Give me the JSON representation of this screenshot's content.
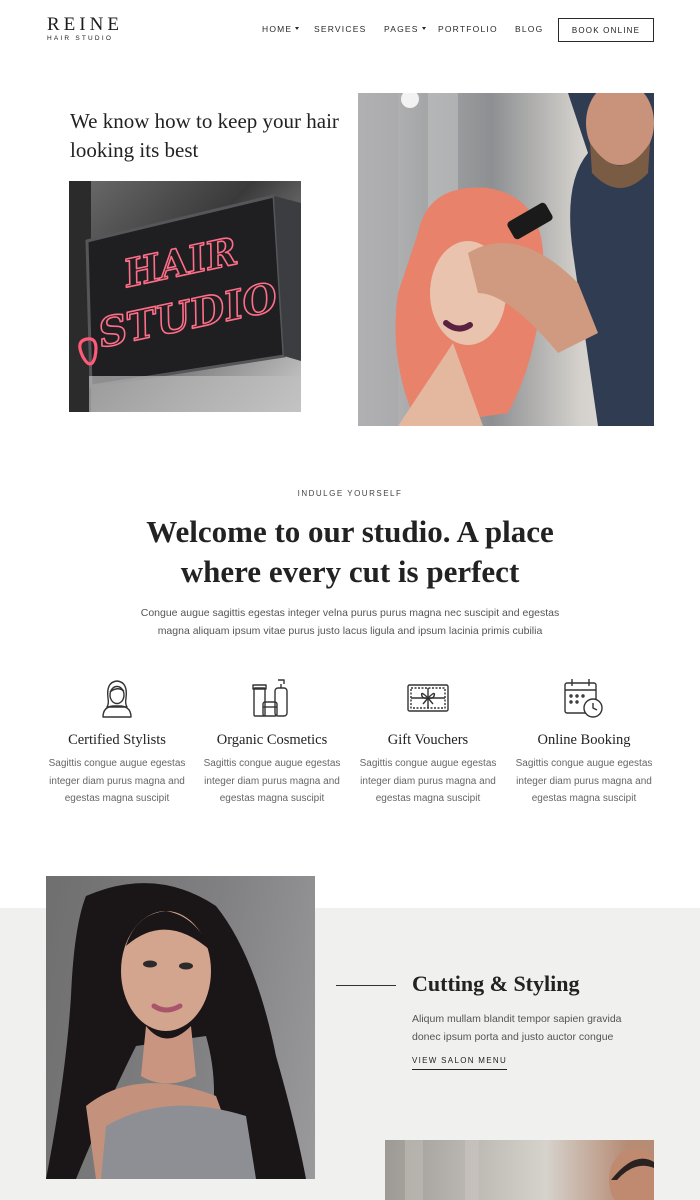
{
  "header": {
    "logo_main": "REINE",
    "logo_sub": "HAIR STUDIO",
    "nav": [
      {
        "label": "HOME",
        "has_dropdown": true
      },
      {
        "label": "SERVICES",
        "has_dropdown": false
      },
      {
        "label": "PAGES",
        "has_dropdown": true
      },
      {
        "label": "PORTFOLIO",
        "has_dropdown": false
      },
      {
        "label": "BLOG",
        "has_dropdown": false
      }
    ],
    "book_button": "BOOK ONLINE"
  },
  "hero": {
    "tagline": "We know how to keep your hair looking its best",
    "sign_text": "HAIR STUDIO"
  },
  "welcome": {
    "eyebrow": "INDULGE YOURSELF",
    "title": "Welcome to our studio. A place where every cut is perfect",
    "body": "Congue augue sagittis egestas integer velna purus purus magna nec suscipit and egestas magna aliquam ipsum vitae purus justo lacus ligula and ipsum lacinia primis cubilia"
  },
  "features": [
    {
      "icon": "stylist-icon",
      "title": "Certified Stylists",
      "text": "Sagittis congue augue egestas integer diam purus magna and egestas magna suscipit"
    },
    {
      "icon": "cosmetics-icon",
      "title": "Organic Cosmetics",
      "text": "Sagittis congue augue egestas integer diam purus magna and egestas magna suscipit"
    },
    {
      "icon": "gift-voucher-icon",
      "title": "Gift Vouchers",
      "text": "Sagittis congue augue egestas integer diam purus magna and egestas magna suscipit"
    },
    {
      "icon": "calendar-clock-icon",
      "title": "Online Booking",
      "text": "Sagittis congue augue egestas integer diam purus magna and egestas magna suscipit"
    }
  ],
  "cutting": {
    "title": "Cutting & Styling",
    "body": "Aliqum mullam blandit tempor sapien gravida donec ipsum porta and justo auctor congue",
    "link": "VIEW SALON MENU"
  },
  "colors": {
    "text": "#222222",
    "band": "#f0f0ee",
    "neon": "#ff5a78",
    "hair": "#e8826a"
  }
}
